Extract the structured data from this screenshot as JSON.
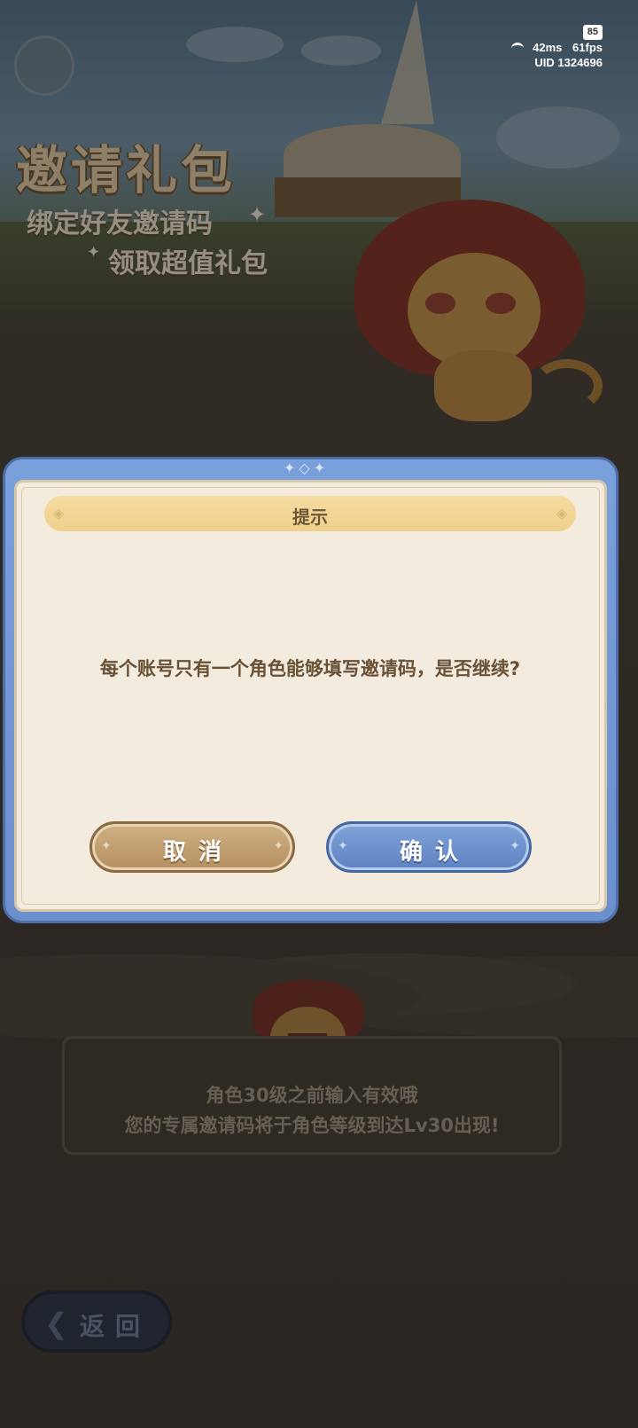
{
  "status": {
    "battery": "85",
    "ping": "42ms",
    "fps": "61fps",
    "uid": "UID 1324696"
  },
  "banner": {
    "title": "邀请礼包",
    "subtitle_line1": "绑定好友邀请码",
    "subtitle_line2": "领取超值礼包"
  },
  "dialog": {
    "title": "提示",
    "message": "每个账号只有一个角色能够填写邀请码，是否继续?",
    "cancel_label": "取消",
    "confirm_label": "确认"
  },
  "hint": {
    "line1": "角色30级之前输入有效哦",
    "line2": "您的专属邀请码将于角色等级到达Lv30出现!"
  },
  "back_button": {
    "label": "返回"
  }
}
